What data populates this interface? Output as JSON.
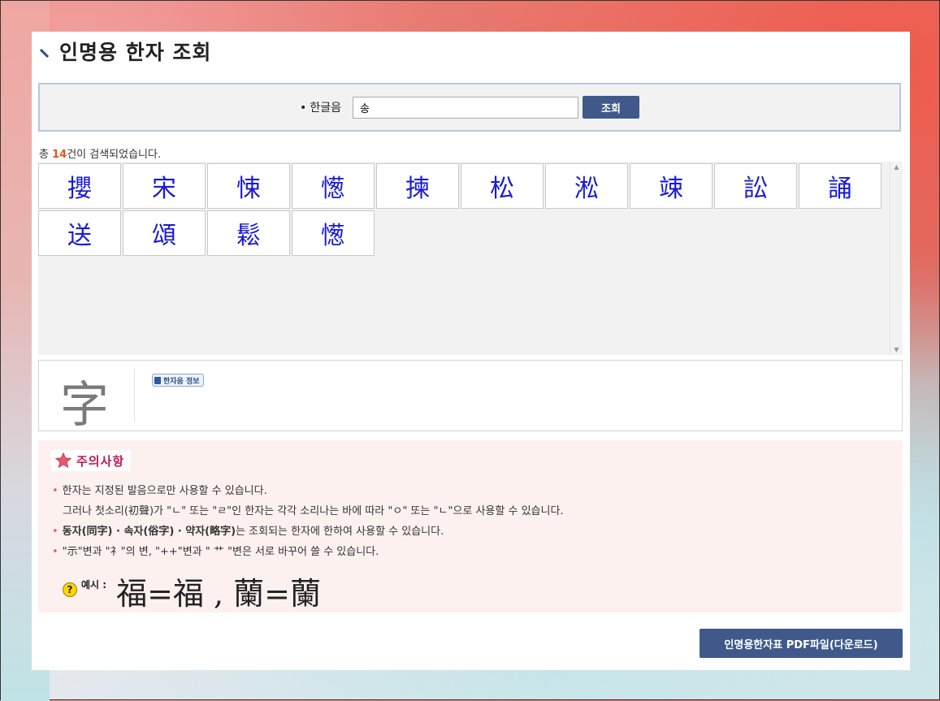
{
  "page": {
    "title": "인명용 한자 조회"
  },
  "search": {
    "label": "한글음",
    "value": "송",
    "button": "조회"
  },
  "result": {
    "prefix": "총 ",
    "count": "14",
    "suffix": "건이 검색되었습니다."
  },
  "characters": [
    "攖",
    "宋",
    "悚",
    "憽",
    "揀",
    "松",
    "淞",
    "竦",
    "訟",
    "誦",
    "送",
    "頌",
    "鬆",
    "憽"
  ],
  "detail": {
    "glyph": "字",
    "badge": "한자음 정보"
  },
  "notice": {
    "title": "주의사항",
    "item1_line1": "한자는 지정된 발음으로만 사용할 수 있습니다.",
    "item1_line2": "그러나 첫소리(初聲)가 \"ㄴ\" 또는 \"ㄹ\"인 한자는 각각 소리나는 바에 따라 \"ㅇ\" 또는 \"ㄴ\"으로 사용할 수 있습니다.",
    "item2_bold": "동자(同字) · 속자(俗字) · 약자(略字)",
    "item2_rest": "는 조회되는 한자에 한하여 사용할 수 있습니다.",
    "item3": "\"示\"변과 \"礻\"의 변, \"++\"변과 \" 艹 \"변은 서로 바꾸어 쓸 수 있습니다.",
    "example_label": "예시 :",
    "example_chars": "福=福 , 蘭=蘭"
  },
  "download": {
    "label": "인명용한자표 PDF파일(다운로드)"
  },
  "colors": {
    "accent": "#3f5a8a",
    "char": "#1a1ad6",
    "count": "#e2531d",
    "notice_bg": "#fdf1f0"
  },
  "icons": {
    "title": "backslash-mark-icon",
    "star": "star-icon",
    "question": "question-icon",
    "book": "book-icon"
  }
}
